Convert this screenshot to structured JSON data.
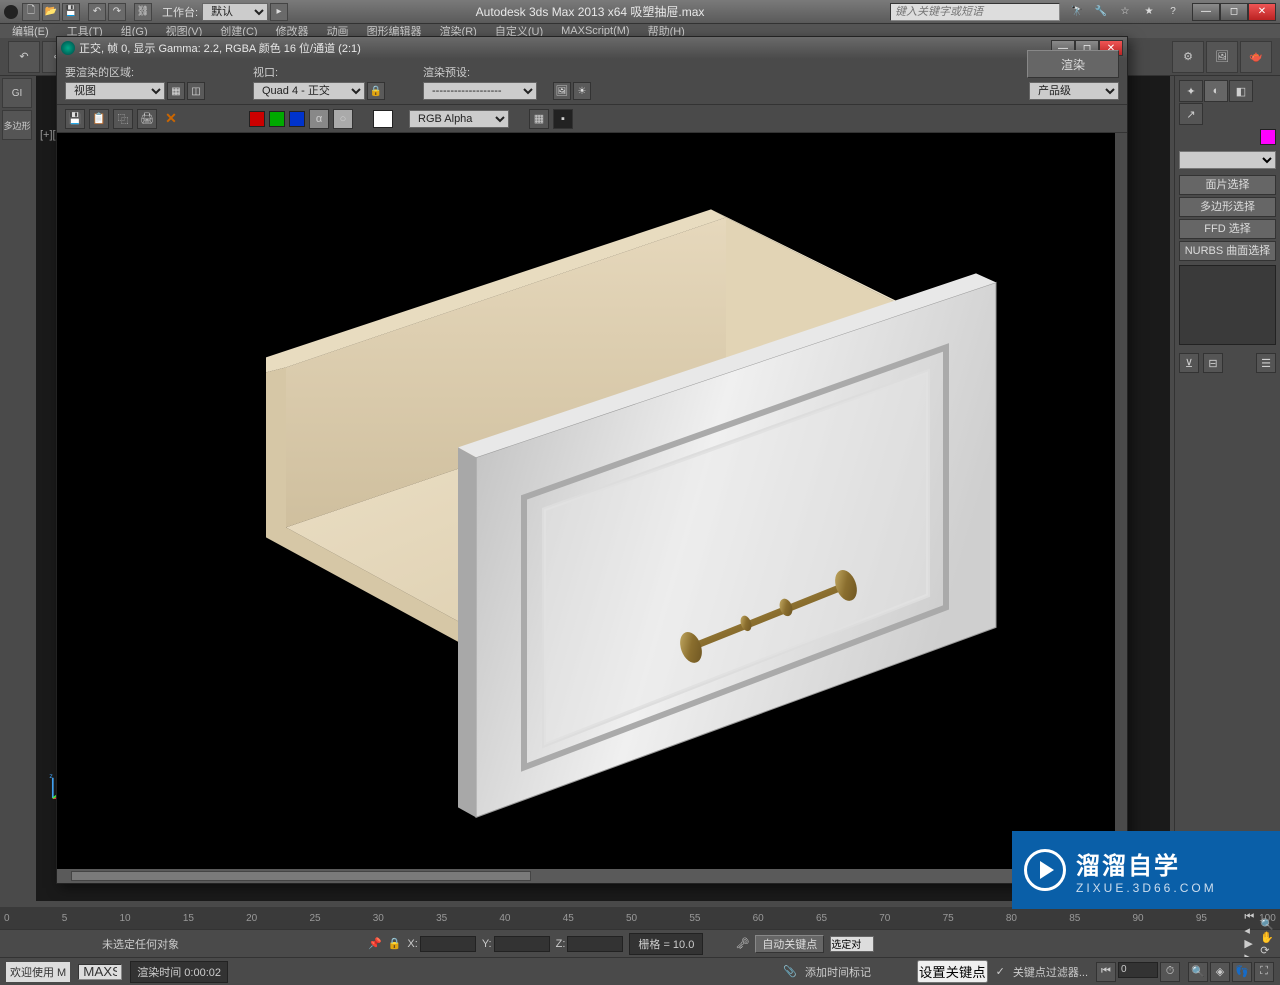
{
  "app": {
    "title": "Autodesk 3ds Max  2013 x64     吸塑抽屉.max",
    "search_placeholder": "键入关键字或短语",
    "workspace_label": "工作台:",
    "workspace_value": "默认"
  },
  "menubar": [
    "编辑(E)",
    "工具(T)",
    "组(G)",
    "视图(V)",
    "创建(C)",
    "修改器",
    "动画",
    "图形编辑器",
    "渲染(R)",
    "自定义(U)",
    "MAXScript(M)",
    "帮助(H)"
  ],
  "viewport_label": "[+][正交",
  "left_label": "多边形",
  "gi_label": "GI",
  "right_panel": {
    "buttons": [
      "面片选择",
      "多边形选择",
      "FFD 选择",
      "NURBS 曲面选择"
    ],
    "color": "#ff33ff"
  },
  "render_window": {
    "title": "正交, 帧 0, 显示 Gamma: 2.2, RGBA 颜色 16 位/通道 (2:1)",
    "area_label": "要渲染的区域:",
    "area_value": "视图",
    "viewport_label": "视口:",
    "viewport_value": "Quad 4 - 正交",
    "preset_label": "渲染预设:",
    "preset_value": "-------------------",
    "render_btn": "渲染",
    "production_value": "产品级",
    "channel_value": "RGB Alpha",
    "colors": {
      "red": "#cc0000",
      "green": "#00aa00",
      "blue": "#0033cc"
    }
  },
  "timeline": {
    "ticks": [
      "0",
      "5",
      "10",
      "15",
      "20",
      "25",
      "30",
      "35",
      "40",
      "45",
      "50",
      "55",
      "60",
      "65",
      "70",
      "75",
      "80",
      "85",
      "90",
      "95",
      "100"
    ]
  },
  "status": {
    "no_selection": "未选定任何对象",
    "x_label": "X:",
    "y_label": "Y:",
    "z_label": "Z:",
    "grid": "栅格 = 10.0",
    "auto_key": "自动关键点",
    "selected": "选定对",
    "welcome": "欢迎使用 M",
    "script": "MAXSc",
    "render_time_label": "渲染时间",
    "render_time_value": "0:00:02",
    "add_time_tag": "添加时间标记",
    "set_key": "设置关键点",
    "key_filter": "关键点过滤器...",
    "frame": "0"
  },
  "watermark": {
    "main": "溜溜自学",
    "sub": "ZIXUE.3D66.COM"
  }
}
